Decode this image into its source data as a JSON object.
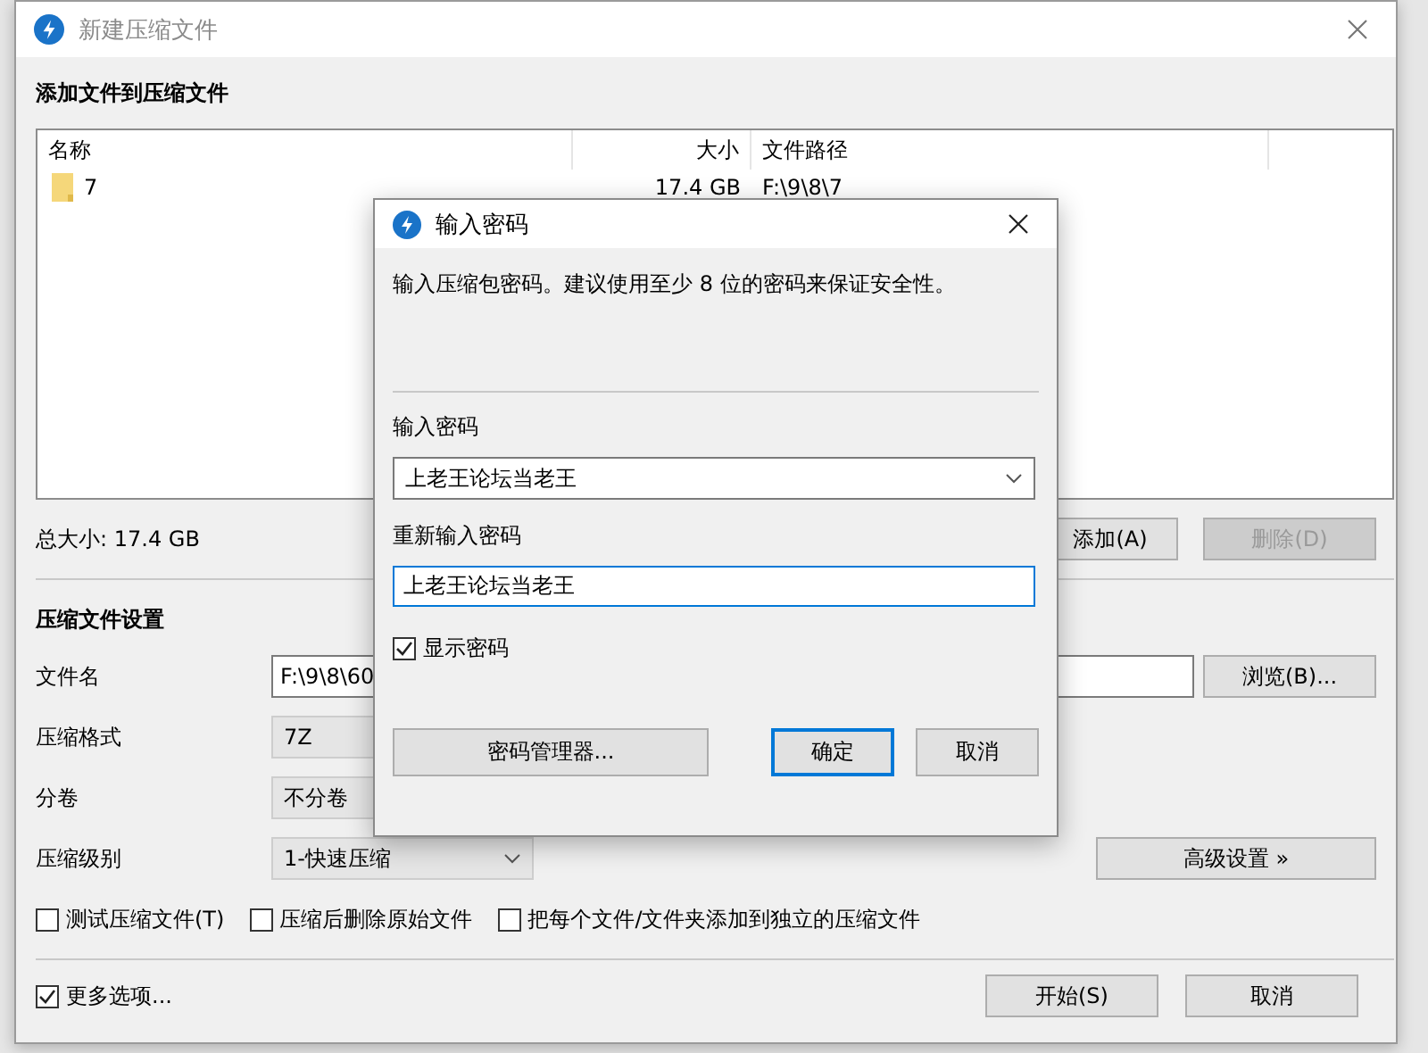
{
  "window": {
    "title": "新建压缩文件"
  },
  "files_section": {
    "heading": "添加文件到压缩文件",
    "columns": [
      "名称",
      "大小",
      "文件路径"
    ],
    "rows": [
      {
        "name": "7",
        "size": "17.4 GB",
        "path": "F:\\9\\8\\7"
      }
    ],
    "total": "总大小: 17.4 GB",
    "buttons": [
      {
        "label": "添加(A)",
        "disabled": false
      },
      {
        "label": "删除(D)",
        "disabled": true
      }
    ]
  },
  "settings": {
    "heading": "压缩文件设置",
    "fields": [
      {
        "label": "文件名",
        "kind": "text",
        "value": "F:\\9\\8\\60",
        "button": "浏览(B)..."
      },
      {
        "label": "压缩格式",
        "kind": "select",
        "value": "7Z"
      },
      {
        "label": "分卷",
        "kind": "select",
        "value": "不分卷"
      },
      {
        "label": "压缩级别",
        "kind": "dropdown",
        "value": "1-快速压缩",
        "button": "高级设置 »"
      }
    ],
    "options": [
      {
        "label": "测试压缩文件(T)",
        "checked": false
      },
      {
        "label": "压缩后删除原始文件",
        "checked": false
      },
      {
        "label": "把每个文件/文件夹添加到独立的压缩文件",
        "checked": false
      }
    ]
  },
  "more_options": {
    "label": "更多选项...",
    "checked": true
  },
  "buttons": [
    "开始(S)",
    "取消"
  ],
  "dialog": {
    "title": "输入密码",
    "message": "输入压缩包密码。建议使用至少 8 位的密码来保证安全性。",
    "password_label": "输入密码",
    "password": "上老王论坛当老王",
    "confirm_label": "重新输入密码",
    "confirm": "上老王论坛当老王",
    "show_password": {
      "label": "显示密码",
      "checked": true
    },
    "manager_button": "密码管理器...",
    "buttons": [
      {
        "label": "确定",
        "default": true
      },
      {
        "label": "取消",
        "default": false
      }
    ]
  }
}
